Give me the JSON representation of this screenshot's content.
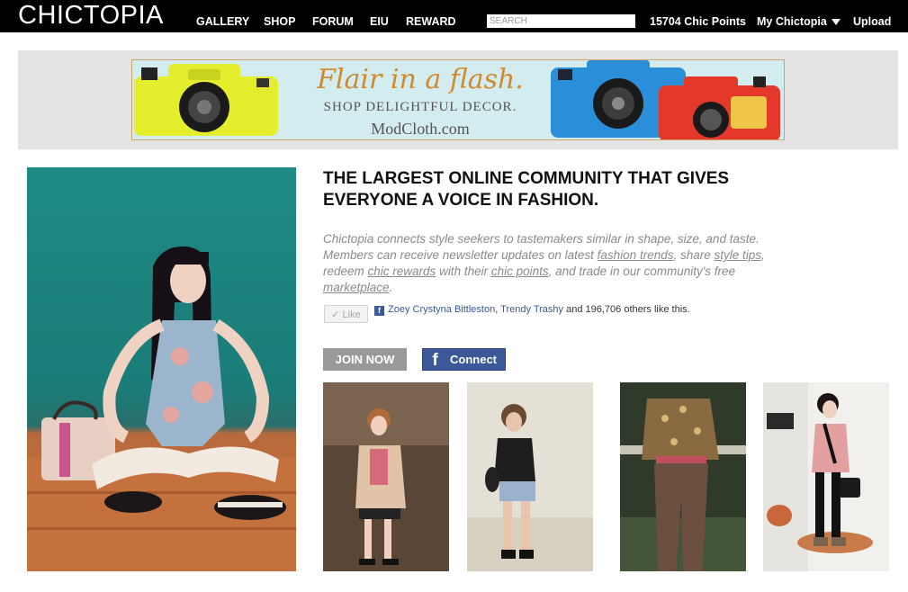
{
  "header": {
    "logo": "CHICTOPIA",
    "nav": [
      "GALLERY",
      "SHOP",
      "FORUM",
      "EIU",
      "REWARD"
    ],
    "search_placeholder": "SEARCH",
    "chic_points": "15704 Chic Points",
    "account_menu": "My Chictopia",
    "upload": "Upload"
  },
  "ad": {
    "headline": "Flair in a flash.",
    "subline": "SHOP DELIGHTFUL DECOR.",
    "brand": "ModCloth.com"
  },
  "main": {
    "headline": "THE LARGEST ONLINE COMMUNITY THAT GIVES EVERYONE A VOICE IN FASHION.",
    "description": {
      "part1": "Chictopia connects style seekers to tastemakers similar in shape, size, and taste. Members can receive newsletter updates on latest ",
      "link1": "fashion trends",
      "part2": ", share ",
      "link2": "style tips",
      "part3": ", redeem ",
      "link3": "chic rewards",
      "part4": " with their ",
      "link4": "chic points",
      "part5": ", and trade in our community's free ",
      "link5": "marketplace",
      "part6": "."
    },
    "like_button": "✓ Like",
    "facebook": {
      "friend1": "Zoey Crystyna Bittleston",
      "separator": ", ",
      "friend2": "Trendy Trashy",
      "suffix": " and 196,706 others like this."
    },
    "join_button": "JOIN NOW",
    "connect_button": "Connect"
  }
}
